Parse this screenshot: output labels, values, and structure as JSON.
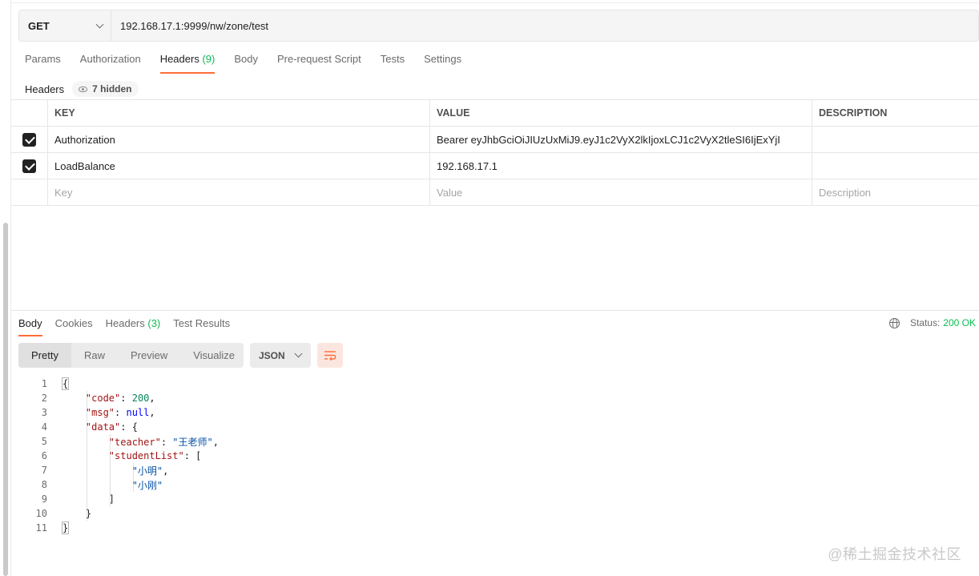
{
  "request": {
    "method": "GET",
    "url": "192.168.17.1:9999/nw/zone/test"
  },
  "request_tabs": [
    {
      "label": "Params"
    },
    {
      "label": "Authorization"
    },
    {
      "label": "Headers",
      "count": "(9)"
    },
    {
      "label": "Body"
    },
    {
      "label": "Pre-request Script"
    },
    {
      "label": "Tests"
    },
    {
      "label": "Settings"
    }
  ],
  "headers_section": {
    "label": "Headers",
    "hidden_badge": "7 hidden"
  },
  "headers_table": {
    "columns": [
      "KEY",
      "VALUE",
      "DESCRIPTION"
    ],
    "rows": [
      {
        "checked": true,
        "key": "Authorization",
        "value": "Bearer eyJhbGciOiJIUzUxMiJ9.eyJ1c2VyX2lkIjoxLCJ1c2VyX2tleSI6IjExYjI",
        "description": ""
      },
      {
        "checked": true,
        "key": "LoadBalance",
        "value": "192.168.17.1",
        "description": ""
      }
    ],
    "placeholders": {
      "key": "Key",
      "value": "Value",
      "description": "Description"
    }
  },
  "response_tabs": [
    {
      "label": "Body"
    },
    {
      "label": "Cookies"
    },
    {
      "label": "Headers",
      "count": "(3)"
    },
    {
      "label": "Test Results"
    }
  ],
  "status": {
    "label": "Status:",
    "value": "200 OK"
  },
  "view_modes": [
    "Pretty",
    "Raw",
    "Preview",
    "Visualize"
  ],
  "format": "JSON",
  "code_line_numbers": [
    "1",
    "2",
    "3",
    "4",
    "5",
    "6",
    "7",
    "8",
    "9",
    "10",
    "11"
  ],
  "watermark": "@稀土掘金技术社区",
  "colors": {
    "accent": "#ff6c37",
    "success": "#0cbb52"
  },
  "icons": [
    "chevron-down-icon",
    "eye-icon",
    "check-icon",
    "globe-icon",
    "wrap-lines-icon"
  ]
}
